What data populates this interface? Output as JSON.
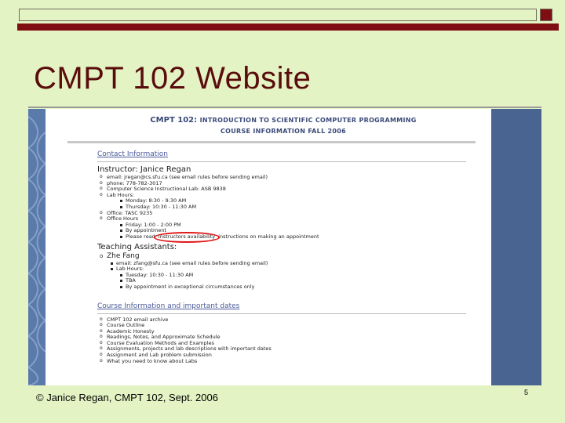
{
  "slide": {
    "title": "CMPT 102 Website",
    "footer": "© Janice Regan, CMPT 102, Sept. 2006",
    "page_number": "5"
  },
  "website": {
    "header_line1_prefix": "CMPT 102:",
    "header_line1_rest": "Introduction to Scientific Computer Programming",
    "header_line2": "Course Information Fall 2006",
    "contact_section": "Contact Information",
    "instructor": "Instructor: Janice Regan",
    "instructor_items": [
      "email: jregan@cs.sfu.ca (see email rules before sending email)",
      "phone: 778-782-3017",
      "Computer Science Instructional Lab: ASB 9838",
      "Lab Hours:"
    ],
    "lab_hours": [
      "Monday: 8:30 - 9:30 AM",
      "Thursday: 10:30 - 11:30 AM"
    ],
    "office": "Office: TASC 9235",
    "office_hours_label": "Office Hours",
    "office_hours": [
      "Friday: 1:00 - 2:00 PM",
      "By appointment",
      "Please read"
    ],
    "office_hours_circled": "instructors availability",
    "office_hours_tail": "instructions on making an appointment",
    "ta_heading": "Teaching Assistants:",
    "ta_name": "Zhe Fang",
    "ta_items": [
      "email: zfang@sfu.ca (see email rules before sending email)",
      "Lab Hours:"
    ],
    "ta_lab_hours": [
      "Tuesday: 10:30 - 11:30 AM",
      "TBA",
      "By appointment in exceptional circumstances only"
    ],
    "course_section": "Course Information and important dates",
    "course_items": [
      "CMPT 102 email archive",
      "Course Outline",
      "Academic Honesty",
      "Readings, Notes, and Approximate Schedule",
      "Course Evaluation Methods and Examples",
      "Assignments, projects and lab descriptions with important dates",
      "Assignment and Lab problem submission",
      "What you need to know about Labs"
    ]
  },
  "colors": {
    "slide_background": "#e3f3c3",
    "accent_red": "#7f0e12",
    "title_color": "#5a0c0c",
    "web_side_blue": "#4a6492",
    "circle_highlight": "#e01818"
  }
}
